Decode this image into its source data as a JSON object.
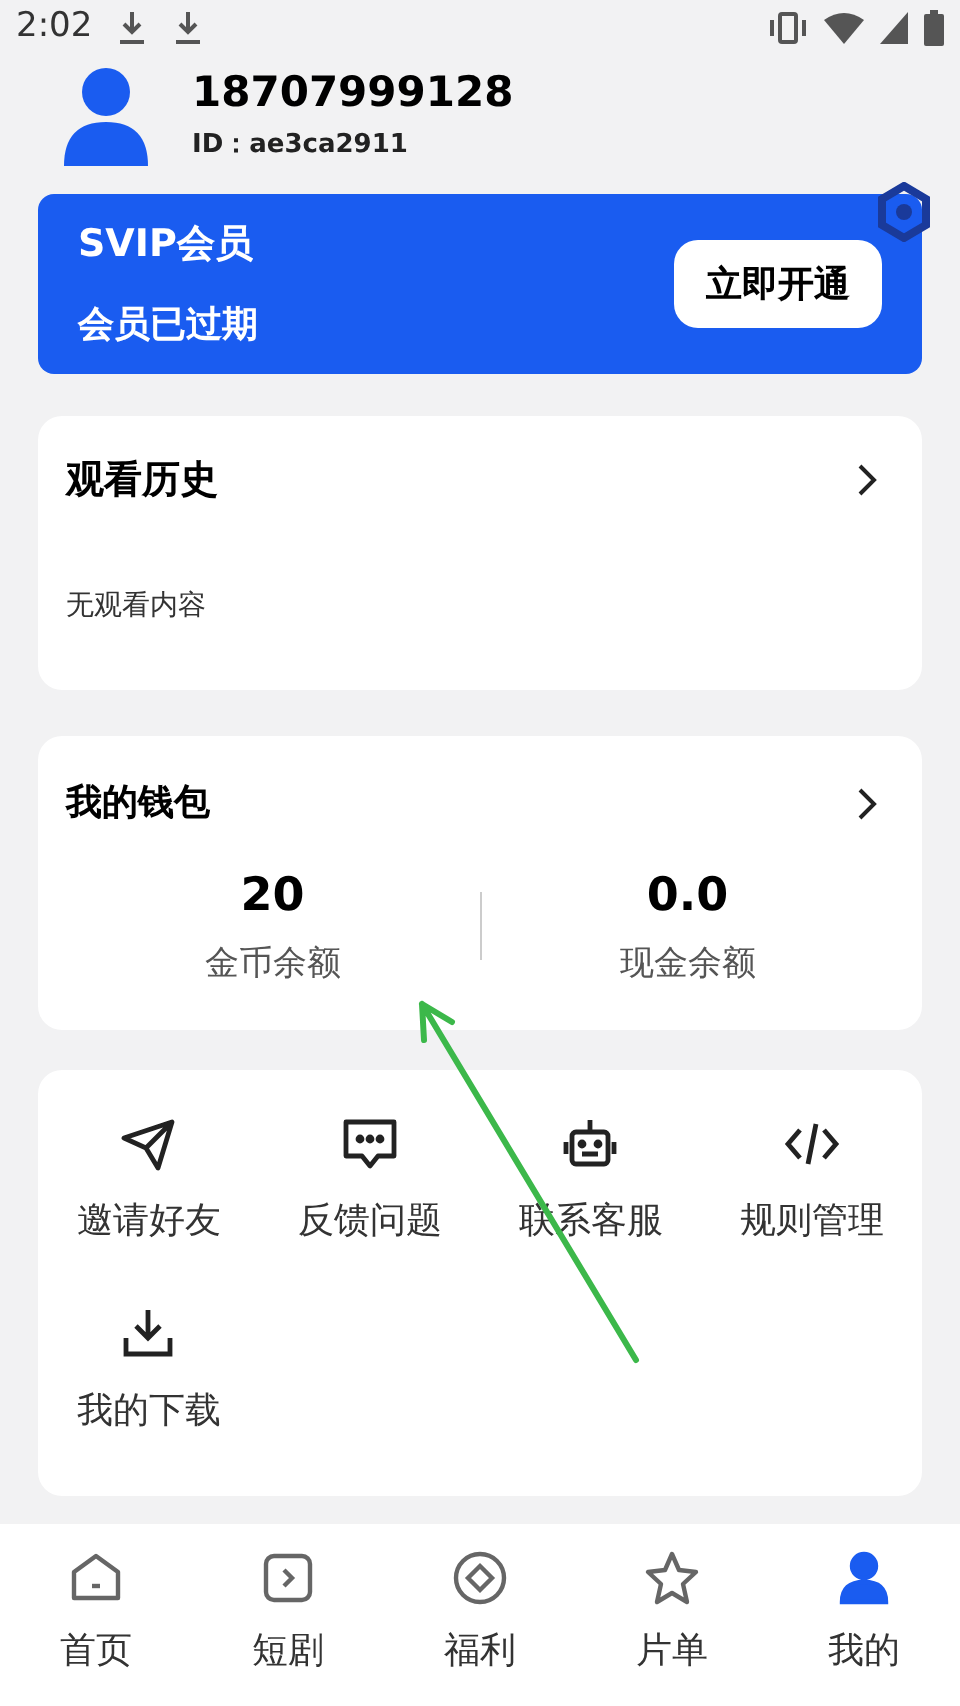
{
  "status_bar": {
    "time": "2:02"
  },
  "profile": {
    "phone": "18707999128",
    "id": "ID：ae3ca2911"
  },
  "vip_card": {
    "title": "SVIP会员",
    "status": "会员已过期",
    "button": "立即开通"
  },
  "history": {
    "title": "观看历史",
    "empty": "无观看内容"
  },
  "wallet": {
    "title": "我的钱包",
    "balances": [
      {
        "value": "20",
        "label": "金币余额"
      },
      {
        "value": "0.0",
        "label": "现金余额"
      }
    ]
  },
  "actions": [
    {
      "kind": "send",
      "label": "邀请好友"
    },
    {
      "kind": "chat",
      "label": "反馈问题"
    },
    {
      "kind": "robot",
      "label": "联系客服"
    },
    {
      "kind": "code",
      "label": "规则管理"
    },
    {
      "kind": "download",
      "label": "我的下载"
    }
  ],
  "nav": [
    {
      "kind": "home",
      "label": "首页",
      "selected": false
    },
    {
      "kind": "play",
      "label": "短剧",
      "selected": false
    },
    {
      "kind": "coin",
      "label": "福利",
      "selected": false
    },
    {
      "kind": "star",
      "label": "片单",
      "selected": false
    },
    {
      "kind": "user",
      "label": "我的",
      "selected": true
    }
  ]
}
